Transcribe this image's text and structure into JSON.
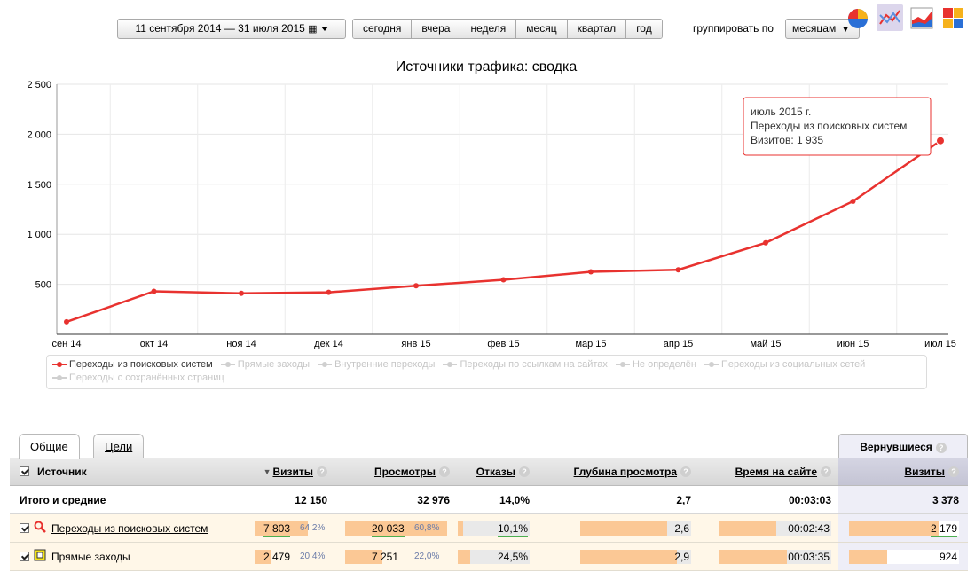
{
  "toolbar": {
    "date_range": "11 сентября 2014 — 31 июля 2015",
    "periods": [
      "сегодня",
      "вчера",
      "неделя",
      "месяц",
      "квартал",
      "год"
    ],
    "group_label": "группировать по",
    "group_value": "месяцам"
  },
  "chart_icons": [
    "pie-chart-icon",
    "line-chart-icon",
    "area-chart-icon",
    "stacked-bar-icon"
  ],
  "colors": {
    "series": "#e8322f",
    "bar": "#fbc895",
    "returned_bg": "#eeeef7"
  },
  "chart_data": {
    "type": "line",
    "title": "Источники трафика: сводка",
    "categories": [
      "сен 14",
      "окт 14",
      "ноя 14",
      "дек 14",
      "янв 15",
      "фев 15",
      "мар 15",
      "апр 15",
      "май 15",
      "июн 15",
      "июл 15"
    ],
    "series": [
      {
        "name": "Переходы из поисковых систем",
        "values": [
          125,
          430,
          410,
          420,
          485,
          545,
          625,
          645,
          915,
          1330,
          1935
        ]
      }
    ],
    "yticks": [
      "500",
      "1 000",
      "1 500",
      "2 000",
      "2 500"
    ],
    "ytick_values": [
      500,
      1000,
      1500,
      2000,
      2500
    ],
    "ylim": [
      0,
      2500
    ],
    "grid": true,
    "tooltip": {
      "line1": "июль 2015 г.",
      "line2": "Переходы из поисковых систем",
      "line3": "Визитов: 1 935"
    }
  },
  "legend": {
    "items": [
      {
        "label": "Переходы из поисковых систем",
        "on": true
      },
      {
        "label": "Прямые заходы",
        "on": false
      },
      {
        "label": "Внутренние переходы",
        "on": false
      },
      {
        "label": "Переходы по ссылкам на сайтах",
        "on": false
      },
      {
        "label": "Не определён",
        "on": false
      },
      {
        "label": "Переходы из социальных сетей",
        "on": false
      },
      {
        "label": "Переходы с сохранённых страниц",
        "on": false
      }
    ]
  },
  "tabs": {
    "general": "Общие",
    "goals": "Цели",
    "returned": "Вернувшиеся"
  },
  "table": {
    "headers": {
      "source": "Источник",
      "visits": "Визиты",
      "views": "Просмотры",
      "bounces": "Отказы",
      "depth": "Глубина просмотра",
      "time": "Время на сайте",
      "ret_visits": "Визиты"
    },
    "total": {
      "label": "Итого и средние",
      "visits": "12 150",
      "views": "32 976",
      "bounces": "14,0%",
      "depth": "2,7",
      "time": "00:03:03",
      "ret_visits": "3 378"
    },
    "rows": [
      {
        "label": "Переходы из поисковых систем",
        "icon": "search-icon",
        "visits": "7 803",
        "visits_pct": "64,2%",
        "visits_share": 0.642,
        "views": "20 033",
        "views_pct": "60,8%",
        "views_share": 0.608,
        "bounces": "10,1%",
        "bounces_share": 0.101,
        "depth": "2,6",
        "depth_share": 0.85,
        "time": "00:02:43",
        "time_share": 0.85,
        "ret_visits": "2 179",
        "ret_share": 0.95
      },
      {
        "label": "Прямые заходы",
        "icon": "bookmark-icon",
        "visits": "2 479",
        "visits_pct": "20,4%",
        "visits_share": 0.204,
        "views": "7 251",
        "views_pct": "22,0%",
        "views_share": 0.22,
        "bounces": "24,5%",
        "bounces_share": 0.245,
        "depth": "2,9",
        "depth_share": 0.95,
        "time": "00:03:35",
        "time_share": 1.0,
        "ret_visits": "924",
        "ret_share": 0.4
      }
    ]
  }
}
